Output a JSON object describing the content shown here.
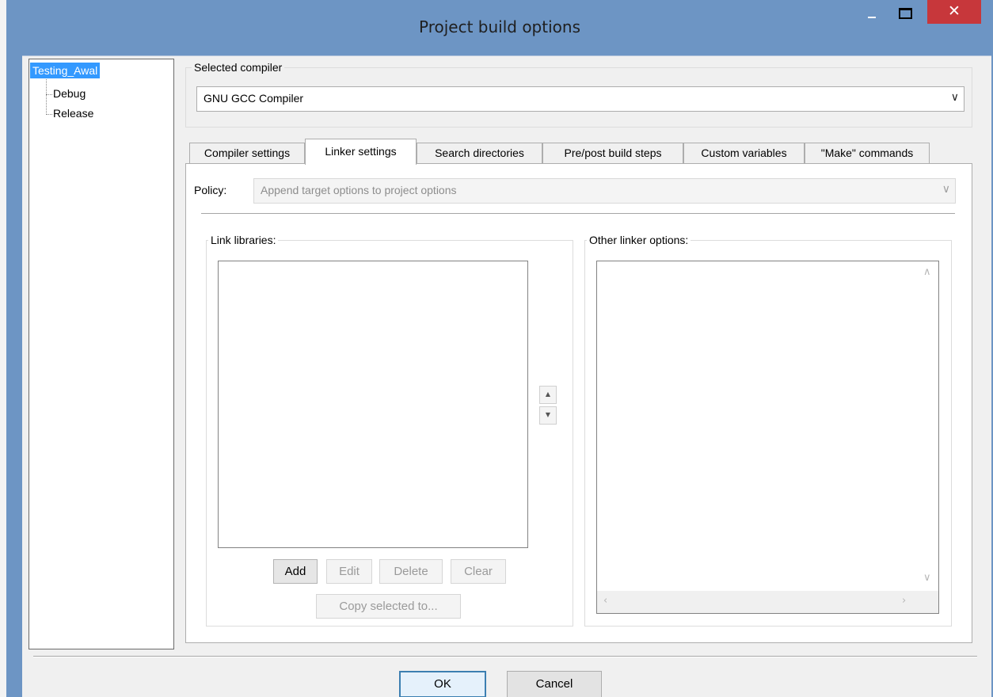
{
  "window": {
    "title": "Project build options",
    "minimize_glyph": "—",
    "maximize_glyph": "□",
    "close_glyph": "✕"
  },
  "tree": {
    "root": "Testing_Awal",
    "children": [
      "Debug",
      "Release"
    ]
  },
  "compiler": {
    "label": "Selected compiler",
    "value": "GNU GCC Compiler"
  },
  "tabs": [
    {
      "label": "Compiler settings"
    },
    {
      "label": "Linker settings"
    },
    {
      "label": "Search directories"
    },
    {
      "label": "Pre/post build steps"
    },
    {
      "label": "Custom variables"
    },
    {
      "label": "\"Make\" commands"
    }
  ],
  "active_tab": "Linker settings",
  "linker": {
    "policy_label": "Policy:",
    "policy_value": "Append target options to project options",
    "link_libraries_label": "Link libraries:",
    "other_options_label": "Other linker options:",
    "buttons": {
      "add": "Add",
      "edit": "Edit",
      "delete": "Delete",
      "clear": "Clear",
      "copy": "Copy selected to..."
    }
  },
  "dialog": {
    "ok": "OK",
    "cancel": "Cancel"
  },
  "colors": {
    "title_bar": "#6d95c4",
    "close_button": "#c7373b",
    "selection": "#3399ff"
  },
  "icons": {
    "dropdown": "chevron-down-icon",
    "spin_up": "triangle-up-icon",
    "spin_down": "triangle-down-icon"
  }
}
